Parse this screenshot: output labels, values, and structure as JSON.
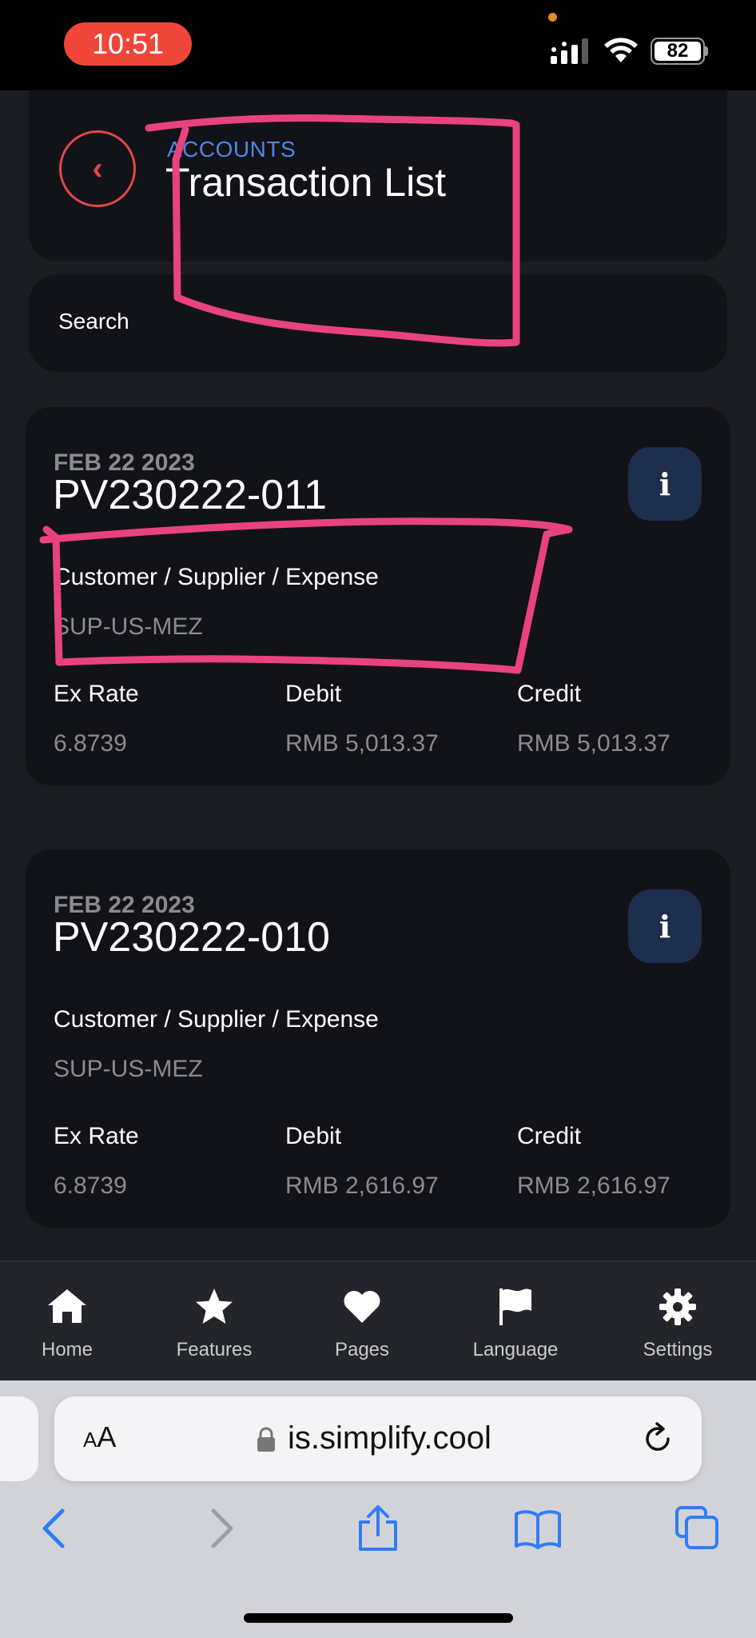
{
  "status_bar": {
    "time": "10:51",
    "battery": "82"
  },
  "header": {
    "breadcrumb": "ACCOUNTS",
    "title": "Transaction List"
  },
  "search": {
    "label": "Search"
  },
  "transactions": [
    {
      "date": "FEB 22 2023",
      "id": "PV230222-011",
      "party_label": "Customer / Supplier / Expense",
      "party_value": "SUP-US-MEZ",
      "ex_rate_label": "Ex Rate",
      "ex_rate": "6.8739",
      "debit_label": "Debit",
      "debit": "RMB 5,013.37",
      "credit_label": "Credit",
      "credit": "RMB 5,013.37"
    },
    {
      "date": "FEB 22 2023",
      "id": "PV230222-010",
      "party_label": "Customer / Supplier / Expense",
      "party_value": "SUP-US-MEZ",
      "ex_rate_label": "Ex Rate",
      "ex_rate": "6.8739",
      "debit_label": "Debit",
      "debit": "RMB 2,616.97",
      "credit_label": "Credit",
      "credit": "RMB 2,616.97"
    }
  ],
  "info_button_glyph": "i",
  "back_glyph": "‹",
  "tabs": [
    {
      "label": "Home",
      "icon": "home-icon"
    },
    {
      "label": "Features",
      "icon": "star-icon"
    },
    {
      "label": "Pages",
      "icon": "heart-icon"
    },
    {
      "label": "Language",
      "icon": "flag-icon"
    },
    {
      "label": "Settings",
      "icon": "gear-icon"
    }
  ],
  "browser": {
    "aa_label_small": "A",
    "aa_label_large": "A",
    "url": "is.simplify.cool"
  },
  "colors": {
    "accent_red": "#e1464b",
    "accent_blue": "#4d87e6",
    "annotation_pink": "#e8437e",
    "ios_blue": "#2f7cf6"
  }
}
